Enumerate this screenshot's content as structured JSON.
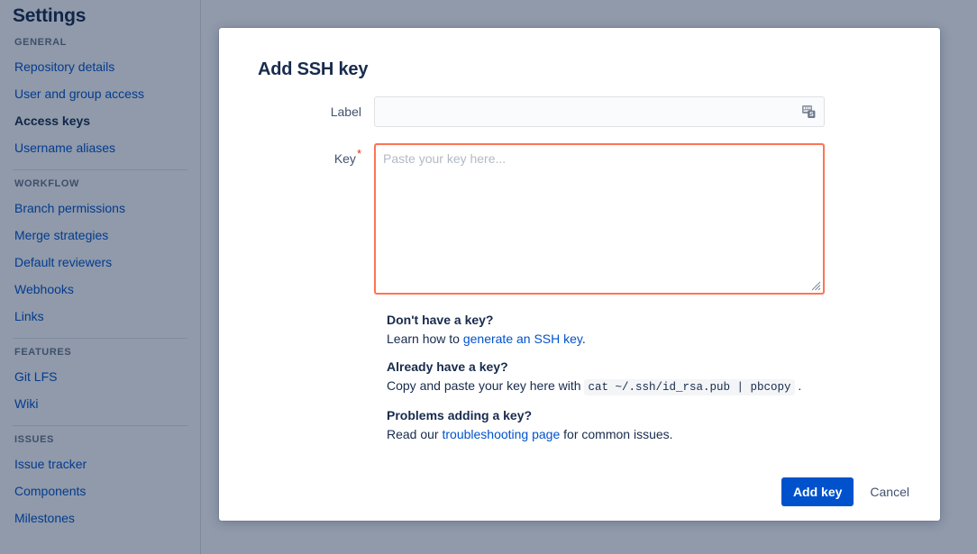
{
  "page": {
    "title": "Settings"
  },
  "sidebar": {
    "groups": [
      {
        "heading": "GENERAL",
        "items": [
          {
            "label": "Repository details",
            "selected": false
          },
          {
            "label": "User and group access",
            "selected": false
          },
          {
            "label": "Access keys",
            "selected": true
          },
          {
            "label": "Username aliases",
            "selected": false
          }
        ]
      },
      {
        "heading": "WORKFLOW",
        "items": [
          {
            "label": "Branch permissions",
            "selected": false
          },
          {
            "label": "Merge strategies",
            "selected": false
          },
          {
            "label": "Default reviewers",
            "selected": false
          },
          {
            "label": "Webhooks",
            "selected": false
          },
          {
            "label": "Links",
            "selected": false
          }
        ]
      },
      {
        "heading": "FEATURES",
        "items": [
          {
            "label": "Git LFS",
            "selected": false
          },
          {
            "label": "Wiki",
            "selected": false
          }
        ]
      },
      {
        "heading": "ISSUES",
        "items": [
          {
            "label": "Issue tracker",
            "selected": false
          },
          {
            "label": "Components",
            "selected": false
          },
          {
            "label": "Milestones",
            "selected": false
          }
        ]
      }
    ]
  },
  "modal": {
    "title": "Add SSH key",
    "fields": {
      "label": {
        "label": "Label",
        "value": "",
        "placeholder": "",
        "icon": "password-autofill-icon"
      },
      "key": {
        "label": "Key",
        "required_marker": "*",
        "value": "",
        "placeholder": "Paste your key here...",
        "invalid": true,
        "border_color": "#ff7452"
      }
    },
    "help": [
      {
        "heading": "Don't have a key?",
        "text_before": "Learn how to ",
        "link": "generate an SSH key",
        "text_after": "."
      },
      {
        "heading": "Already have a key?",
        "text_before": "Copy and paste your key here with ",
        "code": "cat ~/.ssh/id_rsa.pub | pbcopy",
        "text_after": " ."
      },
      {
        "heading": "Problems adding a key?",
        "text_before": "Read our ",
        "link": "troubleshooting page",
        "text_after": " for common issues."
      }
    ],
    "footer": {
      "submit_label": "Add key",
      "cancel_label": "Cancel"
    }
  },
  "colors": {
    "link": "#0052cc",
    "primary_button": "#0052cc",
    "error_border": "#ff7452",
    "required_star": "#de350b",
    "heading_text": "#172b4d",
    "overlay": "#8b96aa"
  }
}
